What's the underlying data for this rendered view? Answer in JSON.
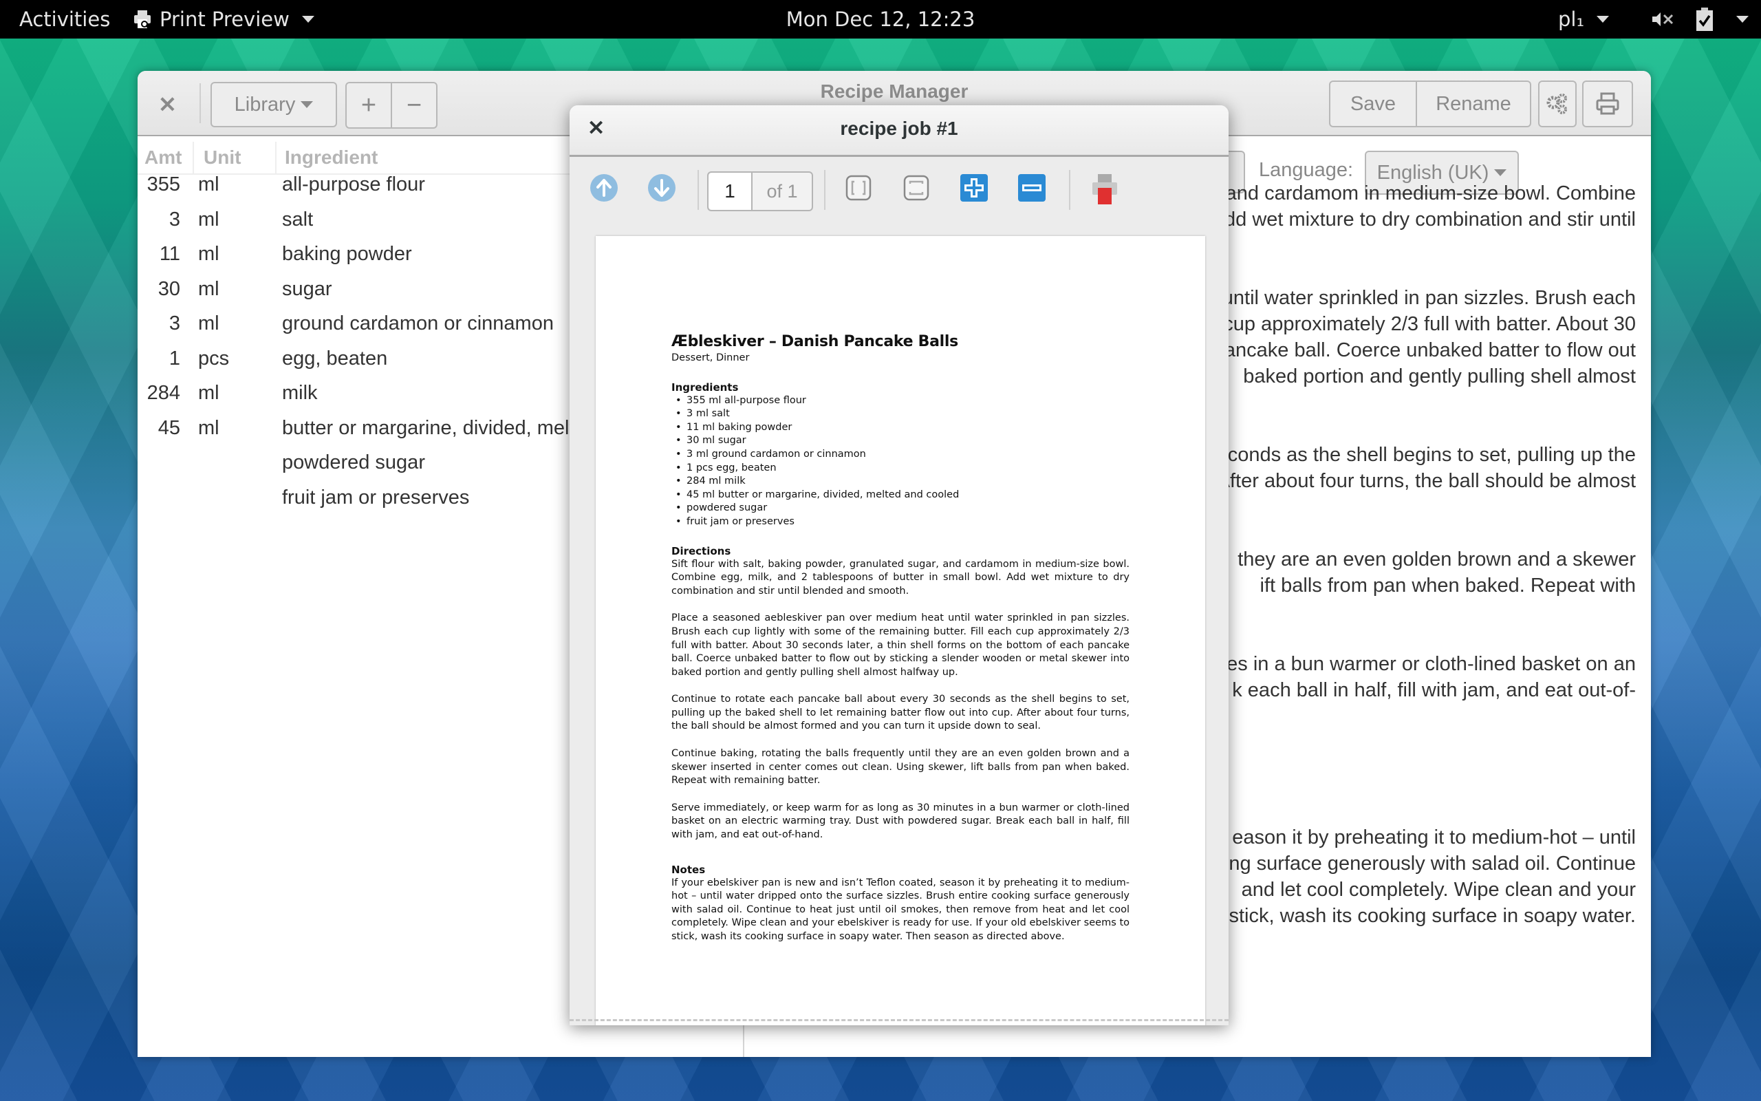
{
  "topbar": {
    "activities": "Activities",
    "app_menu": "Print Preview",
    "clock": "Mon Dec 12, 12:23",
    "input_method": "pl₁"
  },
  "main_window": {
    "title": "Recipe Manager",
    "library_label": "Library",
    "add_label": "+",
    "remove_label": "−",
    "save_label": "Save",
    "rename_label": "Rename",
    "language_label": "Language:",
    "language_value": "English (UK)",
    "columns": [
      "Amt",
      "Unit",
      "Ingredient"
    ],
    "ingredients": [
      {
        "amt": "355",
        "unit": "ml",
        "name": "all-purpose flour"
      },
      {
        "amt": "3",
        "unit": "ml",
        "name": "salt"
      },
      {
        "amt": "11",
        "unit": "ml",
        "name": "baking powder"
      },
      {
        "amt": "30",
        "unit": "ml",
        "name": "sugar"
      },
      {
        "amt": "3",
        "unit": "ml",
        "name": "ground cardamon or cinnamon"
      },
      {
        "amt": "1",
        "unit": "pcs",
        "name": "egg, beaten"
      },
      {
        "amt": "284",
        "unit": "ml",
        "name": "milk"
      },
      {
        "amt": "45",
        "unit": "ml",
        "name": "butter or margarine, divided, melted and cooled"
      },
      {
        "amt": "",
        "unit": "",
        "name": "powdered sugar"
      },
      {
        "amt": "",
        "unit": "",
        "name": "fruit jam or preserves"
      }
    ],
    "visible_text_lines": [
      "and cardamom in medium-size bowl. Combine",
      "dd wet mixture to dry combination and stir until",
      "until water sprinkled in pan sizzles. Brush each",
      "cup approximately 2/3 full with batter. About 30",
      "pancake ball. Coerce unbaked batter to flow out",
      "baked portion and gently pulling shell almost",
      "econds as the shell begins to set, pulling up the",
      "After about four turns, the ball should be almost",
      "they are an even golden brown and a skewer",
      "ift balls from pan when baked. Repeat with",
      "utes in a bun warmer or cloth-lined basket on an",
      "k each ball in half, fill with jam, and eat out-of-",
      "eason it by preheating it to medium-hot – until",
      "king surface generously with salad oil. Continue",
      "and let cool completely. Wipe clean and your",
      "o stick, wash its cooking surface in soapy water."
    ]
  },
  "dialog": {
    "title": "recipe job #1",
    "page_current": "1",
    "page_total_label": "of 1",
    "colors": {
      "accent": "#2a8ad4",
      "nav": "#8fbde0",
      "print_red": "#e03030"
    }
  },
  "paper": {
    "title": "Æbleskiver – Danish Pancake Balls",
    "categories": "Dessert, Dinner",
    "ingredients_heading": "Ingredients",
    "ingredients": [
      "355 ml all-purpose flour",
      "3 ml salt",
      "11 ml baking powder",
      "30 ml sugar",
      "3 ml ground cardamon or cinnamon",
      "1 pcs egg, beaten",
      "284 ml milk",
      "45 ml butter or margarine, divided, melted and cooled",
      "powdered sugar",
      "fruit jam or preserves"
    ],
    "directions_heading": "Directions",
    "directions": [
      "Sift flour with salt, baking powder, granulated sugar, and cardamom in medium-size bowl. Combine egg, milk, and 2 tablespoons of butter in small bowl. Add wet mixture to dry combination and stir until blended and smooth.",
      "Place a seasoned aebleskiver pan over medium heat until water sprinkled in pan sizzles. Brush each cup lightly with some of the remaining butter. Fill each cup approximately 2/3 full with batter. About 30 seconds later, a thin shell forms on the bottom of each pancake ball. Coerce unbaked batter to flow out by sticking a slender wooden or metal skewer into baked portion and gently pulling shell almost halfway up.",
      "Continue to rotate each pancake ball about every 30 seconds as the shell begins to set, pulling up the baked shell to let remaining batter flow out into cup. After about four turns, the ball should be almost formed and you can turn it upside down to seal.",
      "Continue baking, rotating the balls frequently until they are an even golden brown and a skewer inserted in center comes out clean. Using skewer, lift balls from pan when baked. Repeat with remaining batter.",
      "Serve immediately, or keep warm for as long as 30 minutes in a bun warmer or cloth-lined basket on an electric warming tray. Dust with powdered sugar. Break each ball in half, fill with jam, and eat out-of-hand."
    ],
    "notes_heading": "Notes",
    "notes": "If your ebelskiver pan is new and isn’t Teflon coated, season it by preheating it to medium-hot – until water dripped onto the surface sizzles. Brush entire cooking surface generously with salad oil. Continue to heat just until oil smokes, then remove from heat and let cool completely. Wipe clean and your ebelskiver is ready for use. If your old ebelskiver seems to stick, wash its cooking surface in soapy water. Then season as directed above."
  }
}
